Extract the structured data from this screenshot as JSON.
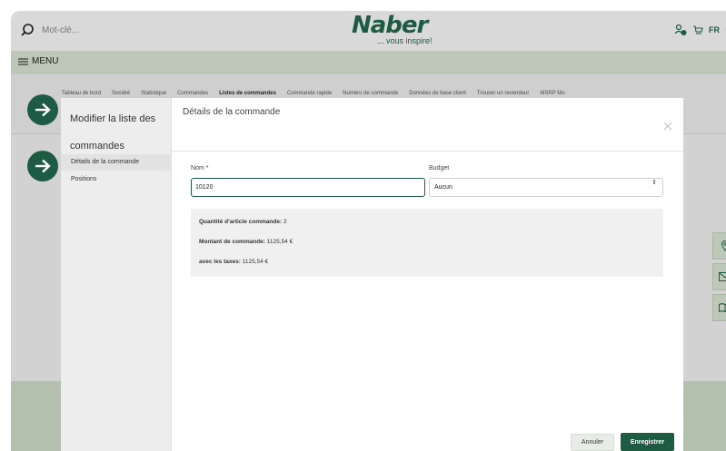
{
  "header": {
    "search_placeholder": "Mot-clé...",
    "logo_text": "Naber",
    "logo_tagline": "... vous inspire!",
    "language": "FR",
    "menu_label": "MENU"
  },
  "nav": {
    "items": [
      {
        "label": "Tableau de bord",
        "active": false
      },
      {
        "label": "Société",
        "active": false
      },
      {
        "label": "Statistique",
        "active": false
      },
      {
        "label": "Commandes",
        "active": false
      },
      {
        "label": "Listes de commandes",
        "active": true
      },
      {
        "label": "Commande rapide",
        "active": false
      },
      {
        "label": "Numéro de commande",
        "active": false
      },
      {
        "label": "Données de base client",
        "active": false
      },
      {
        "label": "Trouver un revendeur",
        "active": false
      },
      {
        "label": "MSRP Mo",
        "active": false
      }
    ]
  },
  "modal": {
    "sidebar_title": "Modifier la liste des commandes",
    "sidebar_items": [
      "Détails de la commande",
      "Positions"
    ],
    "title": "Détails de la commande",
    "name_label": "Nom *",
    "name_value": "10120",
    "budget_label": "Budget",
    "budget_value": "Aucun",
    "summary": {
      "qty_label": "Quantité d'article commande:",
      "qty_value": "2",
      "amount_label": "Montant de commande:",
      "amount_value": "1125,54 €",
      "tax_label": "avec les taxes:",
      "tax_value": "1125,54 €"
    },
    "cancel_label": "Annuler",
    "save_label": "Enregistrer"
  },
  "colors": {
    "brand_green": "#1d5b45",
    "overlay_gray": "#d2d2d2",
    "menu_bar": "#bcc7b7"
  },
  "icons": [
    "search-icon",
    "user-check-icon",
    "cart-icon",
    "chevron-down-icon",
    "hamburger-icon",
    "close-icon",
    "location-pin-icon",
    "mail-icon",
    "book-icon",
    "arrow-right-icon"
  ]
}
